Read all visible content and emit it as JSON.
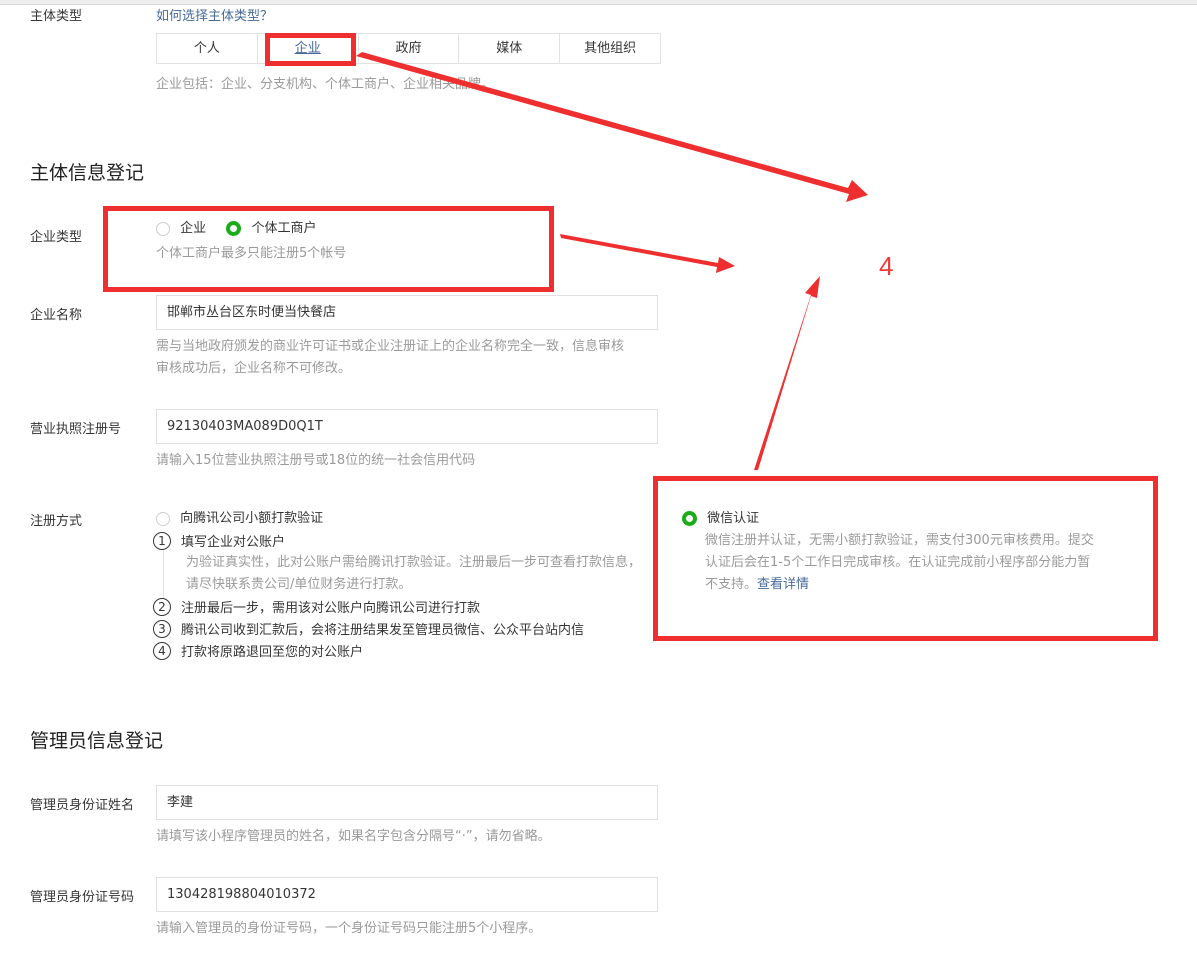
{
  "entity_type": {
    "label": "主体类型",
    "help_link": "如何选择主体类型？",
    "tabs": [
      "个人",
      "企业",
      "政府",
      "媒体",
      "其他组织"
    ],
    "selected_tab": "企业",
    "tip": "企业包括：企业、分支机构、个体工商户、企业相关品牌。"
  },
  "entity_info": {
    "title": "主体信息登记",
    "company_type": {
      "label": "企业类型",
      "options": [
        "企业",
        "个体工商户"
      ],
      "selected": "个体工商户",
      "tip": "个体工商户最多只能注册5个帐号"
    },
    "company_name": {
      "label": "企业名称",
      "value": "邯郸市丛台区东时便当快餐店",
      "tip_line1": "需与当地政府颁发的商业许可证书或企业注册证上的企业名称完全一致，信息审核",
      "tip_line2": "审核成功后，企业名称不可修改。"
    },
    "license_no": {
      "label": "营业执照注册号",
      "value": "92130403MA089D0Q1T",
      "tip": "请输入15位营业执照注册号或18位的统一社会信用代码"
    },
    "register_method": {
      "label": "注册方式",
      "option_bank": "向腾讯公司小额打款验证",
      "step1": "填写企业对公账户",
      "step1_tip_line1": "为验证真实性，此对公账户需给腾讯打款验证。注册最后一步可查看打款信息，",
      "step1_tip_line2": "请尽快联系贵公司/单位财务进行打款。",
      "step2": "注册最后一步，需用该对公账户向腾讯公司进行打款",
      "step3": "腾讯公司收到汇款后，会将注册结果发至管理员微信、公众平台站内信",
      "step4": "打款将原路退回至您的对公账户",
      "step_numbers": [
        "1",
        "2",
        "3",
        "4"
      ],
      "option_wechat": "微信认证",
      "wechat_tip_line1": "微信注册并认证，无需小额打款验证，需支付300元审核费用。提交",
      "wechat_tip_line2": "认证后会在1-5个工作日完成审核。在认证完成前小程序部分能力暂",
      "wechat_tip_line3": "不支持。",
      "wechat_link": "查看详情",
      "selected": "微信认证"
    }
  },
  "admin_info": {
    "title": "管理员信息登记",
    "name": {
      "label": "管理员身份证姓名",
      "value": "李建",
      "tip": "请填写该小程序管理员的姓名，如果名字包含分隔号“·”，请勿省略。"
    },
    "id_no": {
      "label": "管理员身份证号码",
      "value": "130428198804010372",
      "tip": "请输入管理员的身份证号码，一个身份证号码只能注册5个小程序。"
    }
  },
  "annotation": {
    "number": "4",
    "color": "#ef2f2f"
  },
  "colors": {
    "accent_green": "#1aad19",
    "link_blue": "#466b9a",
    "tip_gray": "#9a9a9a"
  }
}
